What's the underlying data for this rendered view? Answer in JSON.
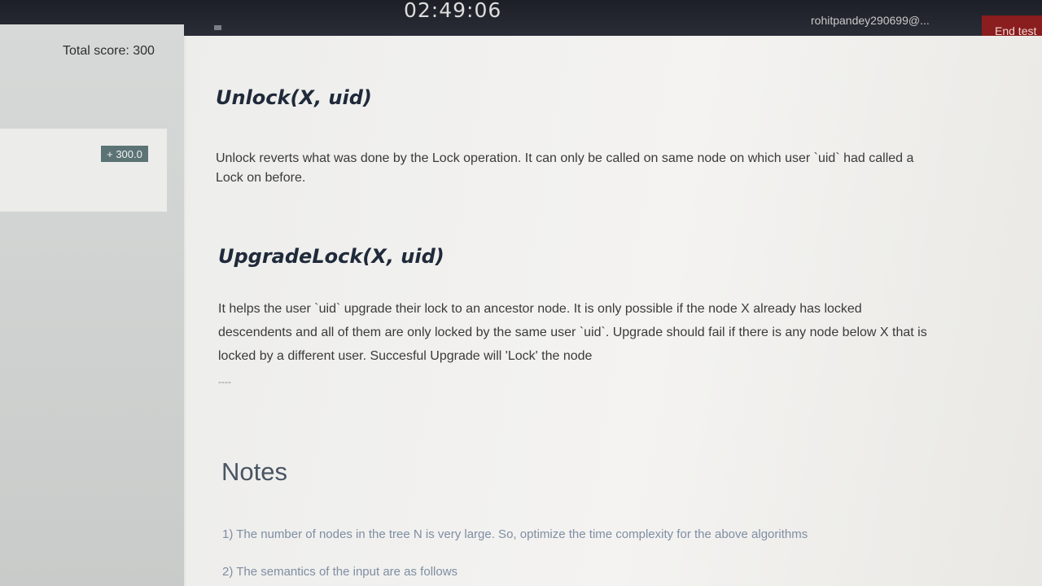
{
  "header": {
    "timer": "02:49:06",
    "user_email": "rohitpandey290699@...",
    "end_test_label": "End test"
  },
  "sidebar": {
    "total_score_label": "Total score: 300",
    "question_score": "+ 300.0"
  },
  "content": {
    "unlock": {
      "title": "Unlock(X, uid)",
      "line1": "Unlock reverts what was done by the Lock operation. It can only be called on same node on which user `uid` had called a",
      "line2": "Lock on before."
    },
    "upgrade": {
      "title": "UpgradeLock(X, uid)",
      "line1": "It helps the user `uid` upgrade their lock to an ancestor node. It is only possible if the node X already has locked",
      "line2": "descendents and all of them are only locked by the same user `uid`. Upgrade should fail if there is any node below X that is",
      "line3": "locked by a different user. Succesful Upgrade will 'Lock' the node"
    },
    "divider": "----",
    "notes": {
      "title": "Notes",
      "items": [
        "1) The number of nodes in the tree N is very large. So, optimize the time complexity for the above algorithms",
        "2) The semantics of the input are as follows"
      ]
    }
  },
  "colors": {
    "topbar": "#1c1f26",
    "end_test_bg": "#8a1d1d",
    "score_badge": "#5b7374",
    "heading": "#1f2a3a",
    "notes_text": "#7f8ea3"
  }
}
